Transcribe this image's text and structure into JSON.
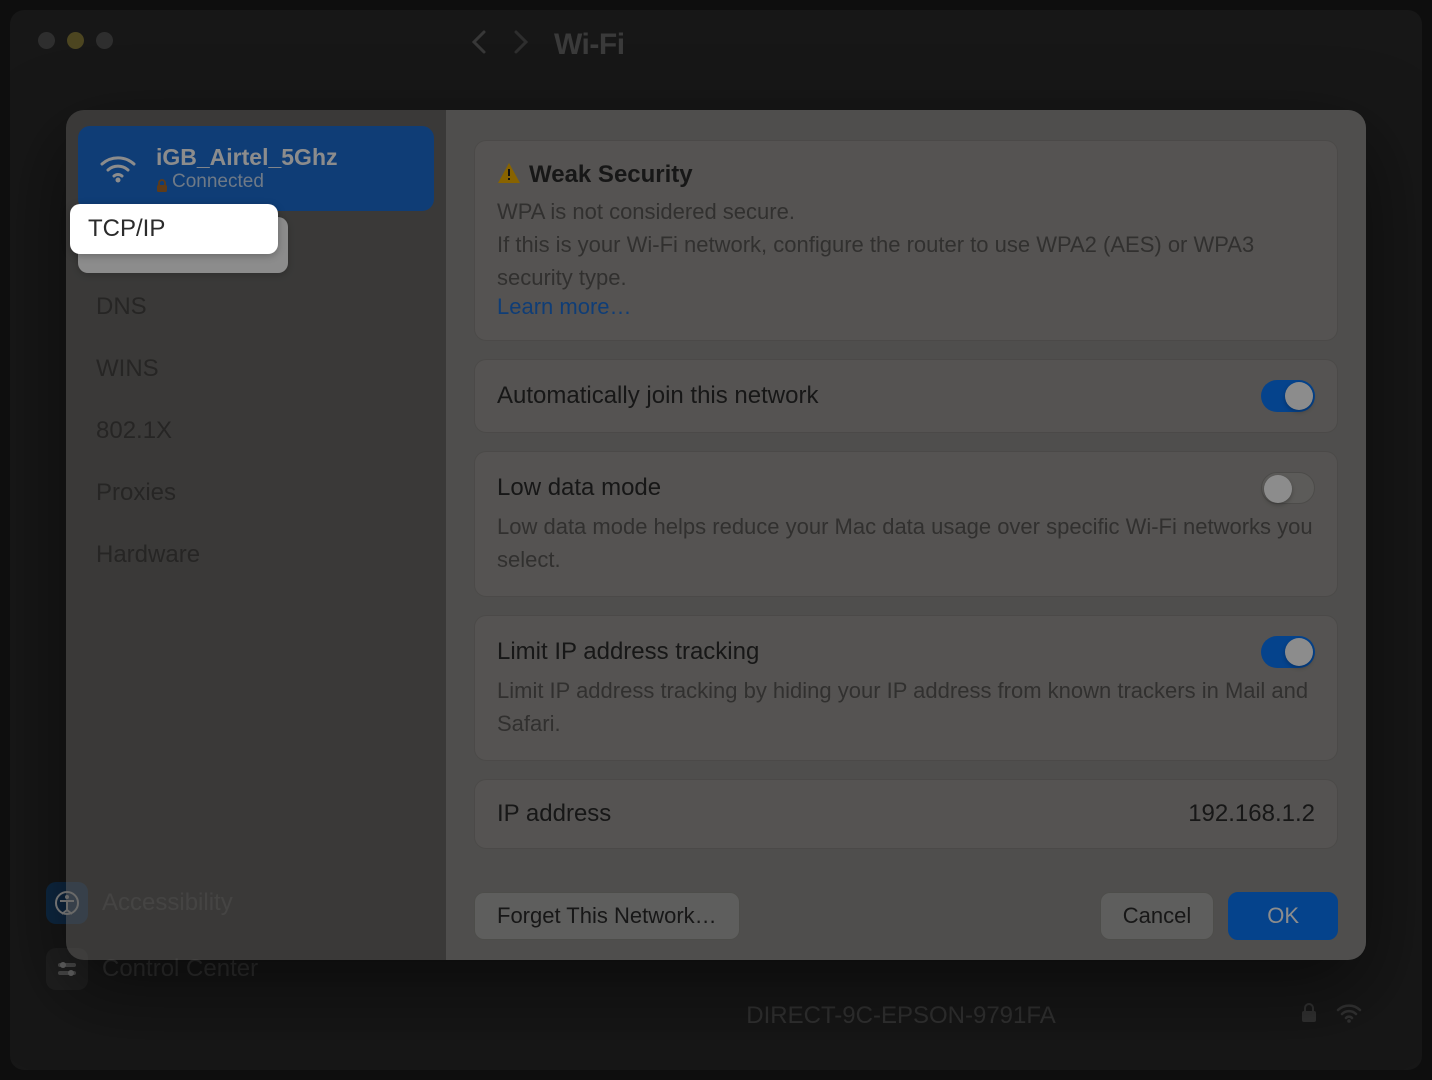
{
  "header": {
    "title": "Wi-Fi"
  },
  "network": {
    "name": "iGB_Airtel_5Ghz",
    "status": "Connected"
  },
  "tabs": [
    {
      "label": "TCP/IP",
      "selected": true
    },
    {
      "label": "DNS"
    },
    {
      "label": "WINS"
    },
    {
      "label": "802.1X"
    },
    {
      "label": "Proxies"
    },
    {
      "label": "Hardware"
    }
  ],
  "weak_security": {
    "title": "Weak Security",
    "line1": "WPA is not considered secure.",
    "line2": "If this is your Wi-Fi network, configure the router to use WPA2 (AES) or WPA3 security type.",
    "learn_more": "Learn more…"
  },
  "auto_join": {
    "label": "Automatically join this network",
    "on": true
  },
  "low_data": {
    "label": "Low data mode",
    "desc": "Low data mode helps reduce your Mac data usage over specific Wi-Fi networks you select.",
    "on": false
  },
  "limit_ip": {
    "label": "Limit IP address tracking",
    "desc": "Limit IP address tracking by hiding your IP address from known trackers in Mail and Safari.",
    "on": true
  },
  "ip": {
    "label": "IP address",
    "value": "192.168.1.2"
  },
  "buttons": {
    "forget": "Forget This Network…",
    "cancel": "Cancel",
    "ok": "OK"
  },
  "background": {
    "accessibility": "Accessibility",
    "control_center": "Control Center",
    "other_network": "DIRECT-9C-EPSON-9791FA"
  }
}
